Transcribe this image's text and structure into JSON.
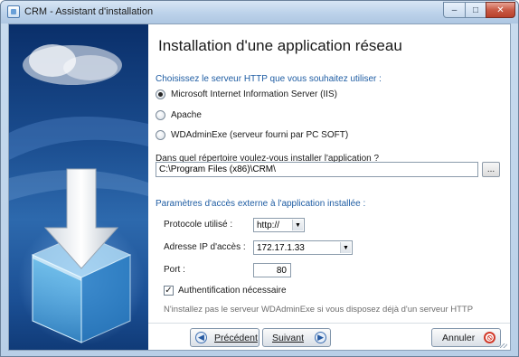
{
  "window": {
    "title": "CRM - Assistant d'installation",
    "controls": {
      "minimize": "–",
      "maximize": "□",
      "close": "✕"
    }
  },
  "main": {
    "page_title": "Installation d'une application réseau",
    "server_section": {
      "label": "Choisissez le serveur  HTTP que vous souhaitez utiliser :",
      "options": [
        {
          "label": "Microsoft Internet Information Server (IIS)",
          "selected": true
        },
        {
          "label": "Apache",
          "selected": false
        },
        {
          "label": "WDAdminExe (serveur fourni par PC SOFT)",
          "selected": false
        }
      ]
    },
    "directory": {
      "question": "Dans quel répertoire voulez-vous installer l'application ?",
      "value": "C:\\Program Files (x86)\\CRM\\",
      "browse_label": "..."
    },
    "access_section": {
      "label": "Paramètres d'accès externe à l'application installée :",
      "protocol_label": "Protocole utilisé :",
      "protocol_value": "http://",
      "ip_label": "Adresse IP d'accès :",
      "ip_value": "172.17.1.33",
      "port_label": "Port :",
      "port_value": "80",
      "auth_label": "Authentification nécessaire",
      "auth_checked": true
    },
    "note": "N'installez pas le serveur WDAdminExe si vous disposez déjà d'un serveur HTTP"
  },
  "footer": {
    "prev_label": "Précédent",
    "next_label": "Suivant",
    "cancel_label": "Annuler"
  },
  "icons": {
    "app": "app-window-icon",
    "side_illustration": "install-box-arrow-icon",
    "prev": "arrow-left-icon",
    "next": "arrow-right-icon",
    "cancel": "no-entry-icon"
  },
  "colors": {
    "section_label": "#1f5da3",
    "side_panel": "#1a4c8e",
    "close_button": "#c95a45"
  }
}
